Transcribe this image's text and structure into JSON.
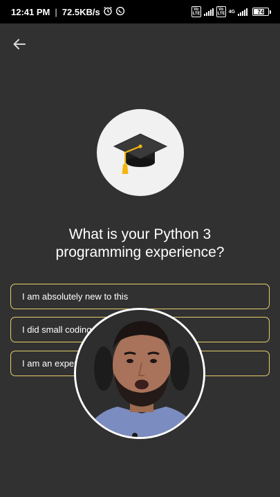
{
  "status_bar": {
    "time": "12:41 PM",
    "speed": "72.5KB/s",
    "icons": [
      "alarm-icon",
      "whatsapp-icon"
    ],
    "volte_1": "Vo LTE",
    "volte_2": "Vo LTE",
    "network": "4G",
    "battery": "74"
  },
  "nav": {
    "back_icon": "arrow-left-icon"
  },
  "hero": {
    "icon": "graduation-cap-icon"
  },
  "question": {
    "line1": "What is your Python 3",
    "line2": "programming experience?"
  },
  "options": [
    {
      "label": "I am absolutely new to this"
    },
    {
      "label": "I did small coding"
    },
    {
      "label": "I am an experi"
    }
  ],
  "video_overlay": {
    "subject": "presenter-webcam"
  },
  "colors": {
    "background": "#313131",
    "statusbar": "#000000",
    "option_border": "#e8cf6a",
    "tassel": "#f2b70e"
  }
}
